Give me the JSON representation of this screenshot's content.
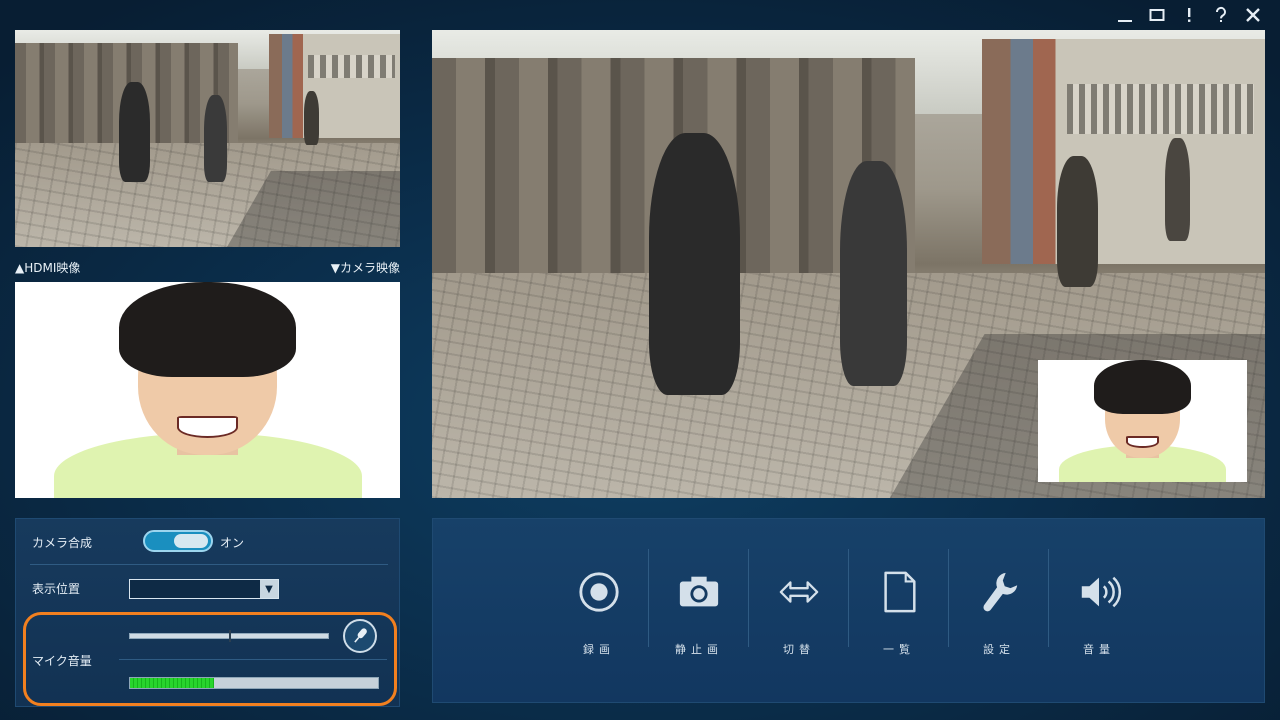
{
  "labels": {
    "hdmi": "▲HDMI映像",
    "camera": "▼カメラ映像"
  },
  "settings": {
    "camera_compose": {
      "label": "カメラ合成",
      "state": "オン"
    },
    "position": {
      "label": "表示位置",
      "value": ""
    },
    "mic": {
      "label": "マイク音量",
      "volume_level": 0.5,
      "meter_level": 0.34
    }
  },
  "controls": [
    {
      "label": "録画",
      "icon": "record-icon"
    },
    {
      "label": "静止画",
      "icon": "camera-icon"
    },
    {
      "label": "切替",
      "icon": "switch-arrows-icon"
    },
    {
      "label": "一覧",
      "icon": "document-icon"
    },
    {
      "label": "設定",
      "icon": "wrench-icon"
    },
    {
      "label": "音量",
      "icon": "speaker-icon"
    }
  ],
  "colors": {
    "accent": "#1a8fbf",
    "highlight": "#f2801f",
    "meter": "#28d52d"
  }
}
